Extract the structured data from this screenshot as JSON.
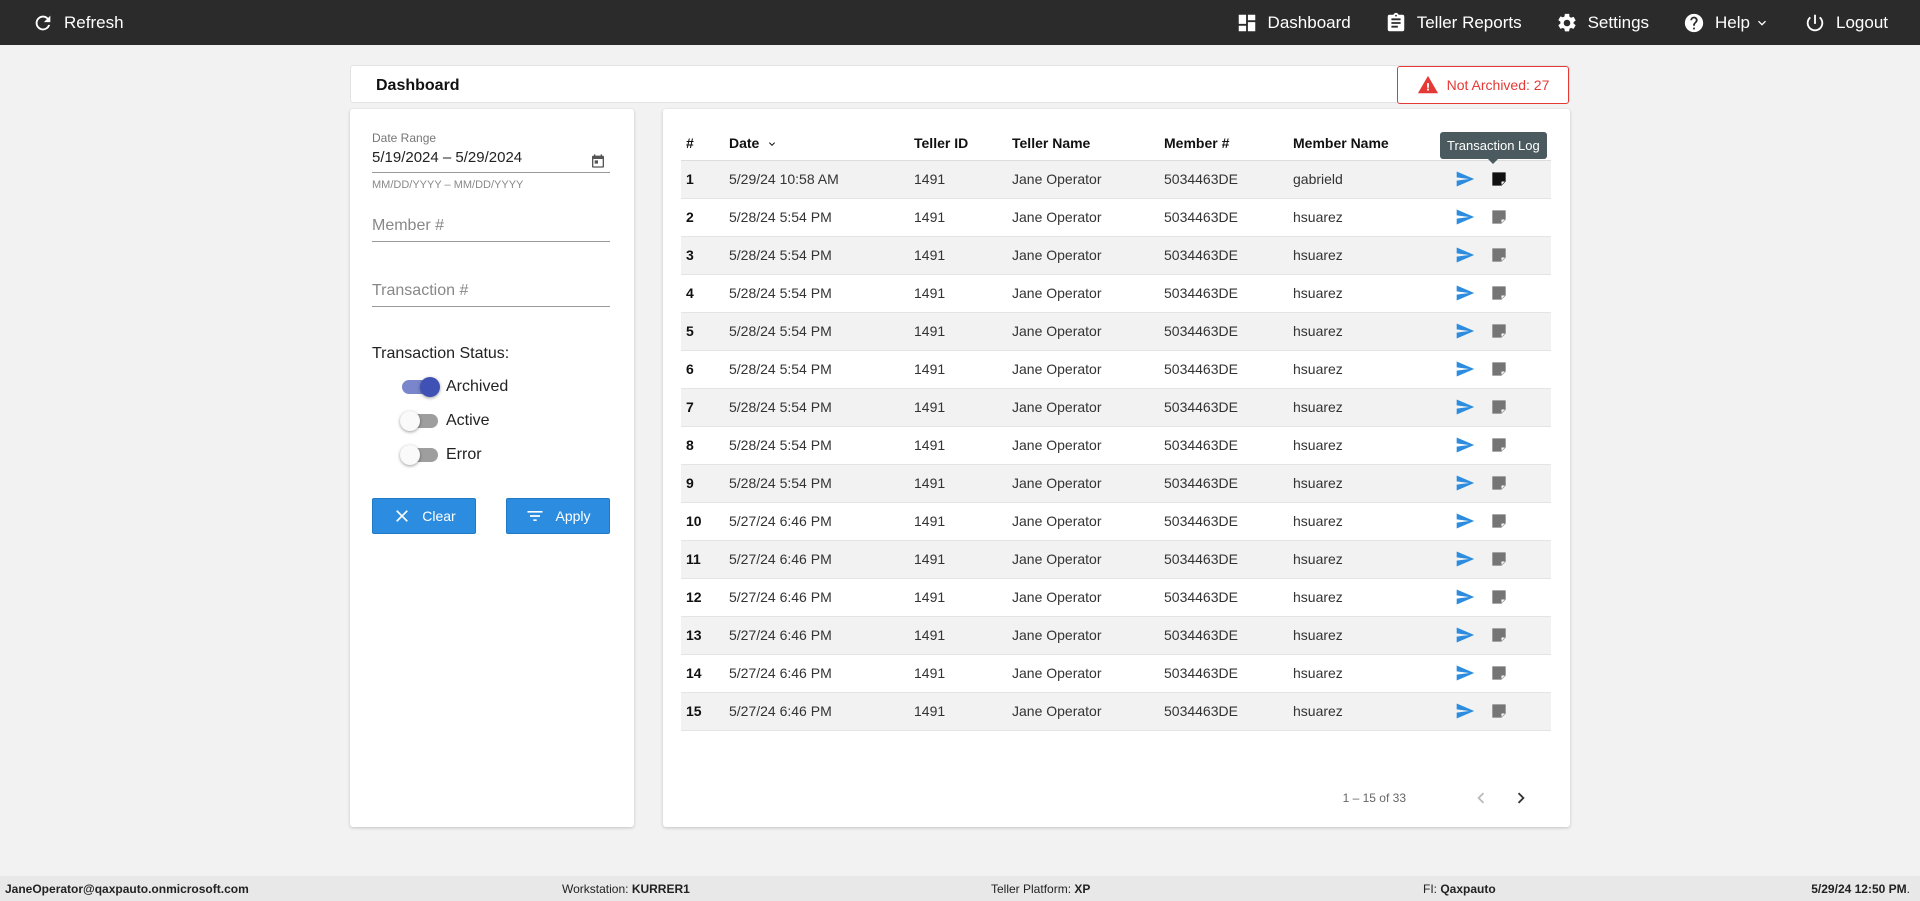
{
  "topbar": {
    "refresh_label": "Refresh",
    "nav": [
      {
        "label": "Dashboard",
        "icon": "dashboard-icon"
      },
      {
        "label": "Teller Reports",
        "icon": "clipboard-icon"
      },
      {
        "label": "Settings",
        "icon": "gear-icon"
      },
      {
        "label": "Help",
        "icon": "help-icon"
      },
      {
        "label": "Logout",
        "icon": "power-icon"
      }
    ]
  },
  "header": {
    "title": "Dashboard",
    "not_archived_label": "Not Archived: 27",
    "alert_color": "#e53935"
  },
  "filters": {
    "date_range_label": "Date Range",
    "date_range_value": "5/19/2024 – 5/29/2024",
    "date_range_hint": "MM/DD/YYYY – MM/DD/YYYY",
    "member_placeholder": "Member #",
    "transaction_placeholder": "Transaction #",
    "status_label": "Transaction Status:",
    "statuses": [
      {
        "label": "Archived",
        "on": true
      },
      {
        "label": "Active",
        "on": false
      },
      {
        "label": "Error",
        "on": false
      }
    ],
    "clear_label": "Clear",
    "apply_label": "Apply",
    "accent_color": "#2c8de0"
  },
  "table": {
    "columns": [
      "#",
      "Date",
      "Teller ID",
      "Teller Name",
      "Member #",
      "Member Name"
    ],
    "rows": [
      {
        "num": "1",
        "date": "5/29/24 10:58 AM",
        "teller_id": "1491",
        "teller_name": "Jane Operator",
        "member": "5034463DE",
        "member_name": "gabrield"
      },
      {
        "num": "2",
        "date": "5/28/24 5:54 PM",
        "teller_id": "1491",
        "teller_name": "Jane Operator",
        "member": "5034463DE",
        "member_name": "hsuarez"
      },
      {
        "num": "3",
        "date": "5/28/24 5:54 PM",
        "teller_id": "1491",
        "teller_name": "Jane Operator",
        "member": "5034463DE",
        "member_name": "hsuarez"
      },
      {
        "num": "4",
        "date": "5/28/24 5:54 PM",
        "teller_id": "1491",
        "teller_name": "Jane Operator",
        "member": "5034463DE",
        "member_name": "hsuarez"
      },
      {
        "num": "5",
        "date": "5/28/24 5:54 PM",
        "teller_id": "1491",
        "teller_name": "Jane Operator",
        "member": "5034463DE",
        "member_name": "hsuarez"
      },
      {
        "num": "6",
        "date": "5/28/24 5:54 PM",
        "teller_id": "1491",
        "teller_name": "Jane Operator",
        "member": "5034463DE",
        "member_name": "hsuarez"
      },
      {
        "num": "7",
        "date": "5/28/24 5:54 PM",
        "teller_id": "1491",
        "teller_name": "Jane Operator",
        "member": "5034463DE",
        "member_name": "hsuarez"
      },
      {
        "num": "8",
        "date": "5/28/24 5:54 PM",
        "teller_id": "1491",
        "teller_name": "Jane Operator",
        "member": "5034463DE",
        "member_name": "hsuarez"
      },
      {
        "num": "9",
        "date": "5/28/24 5:54 PM",
        "teller_id": "1491",
        "teller_name": "Jane Operator",
        "member": "5034463DE",
        "member_name": "hsuarez"
      },
      {
        "num": "10",
        "date": "5/27/24 6:46 PM",
        "teller_id": "1491",
        "teller_name": "Jane Operator",
        "member": "5034463DE",
        "member_name": "hsuarez"
      },
      {
        "num": "11",
        "date": "5/27/24 6:46 PM",
        "teller_id": "1491",
        "teller_name": "Jane Operator",
        "member": "5034463DE",
        "member_name": "hsuarez"
      },
      {
        "num": "12",
        "date": "5/27/24 6:46 PM",
        "teller_id": "1491",
        "teller_name": "Jane Operator",
        "member": "5034463DE",
        "member_name": "hsuarez"
      },
      {
        "num": "13",
        "date": "5/27/24 6:46 PM",
        "teller_id": "1491",
        "teller_name": "Jane Operator",
        "member": "5034463DE",
        "member_name": "hsuarez"
      },
      {
        "num": "14",
        "date": "5/27/24 6:46 PM",
        "teller_id": "1491",
        "teller_name": "Jane Operator",
        "member": "5034463DE",
        "member_name": "hsuarez"
      },
      {
        "num": "15",
        "date": "5/27/24 6:46 PM",
        "teller_id": "1491",
        "teller_name": "Jane Operator",
        "member": "5034463DE",
        "member_name": "hsuarez"
      }
    ],
    "tooltip": "Transaction Log",
    "pagination": "1 – 15 of 33",
    "send_icon_color": "#2c8de0"
  },
  "footer": {
    "user": "JaneOperator@qaxpauto.onmicrosoft.com",
    "workstation_label": "Workstation:",
    "workstation": "KURRER1",
    "platform_label": "Teller Platform:",
    "platform": "XP",
    "fi_label": "FI:",
    "fi": "Qaxpauto",
    "datetime": "5/29/24 12:50 PM",
    "datetime_suffix": "."
  }
}
